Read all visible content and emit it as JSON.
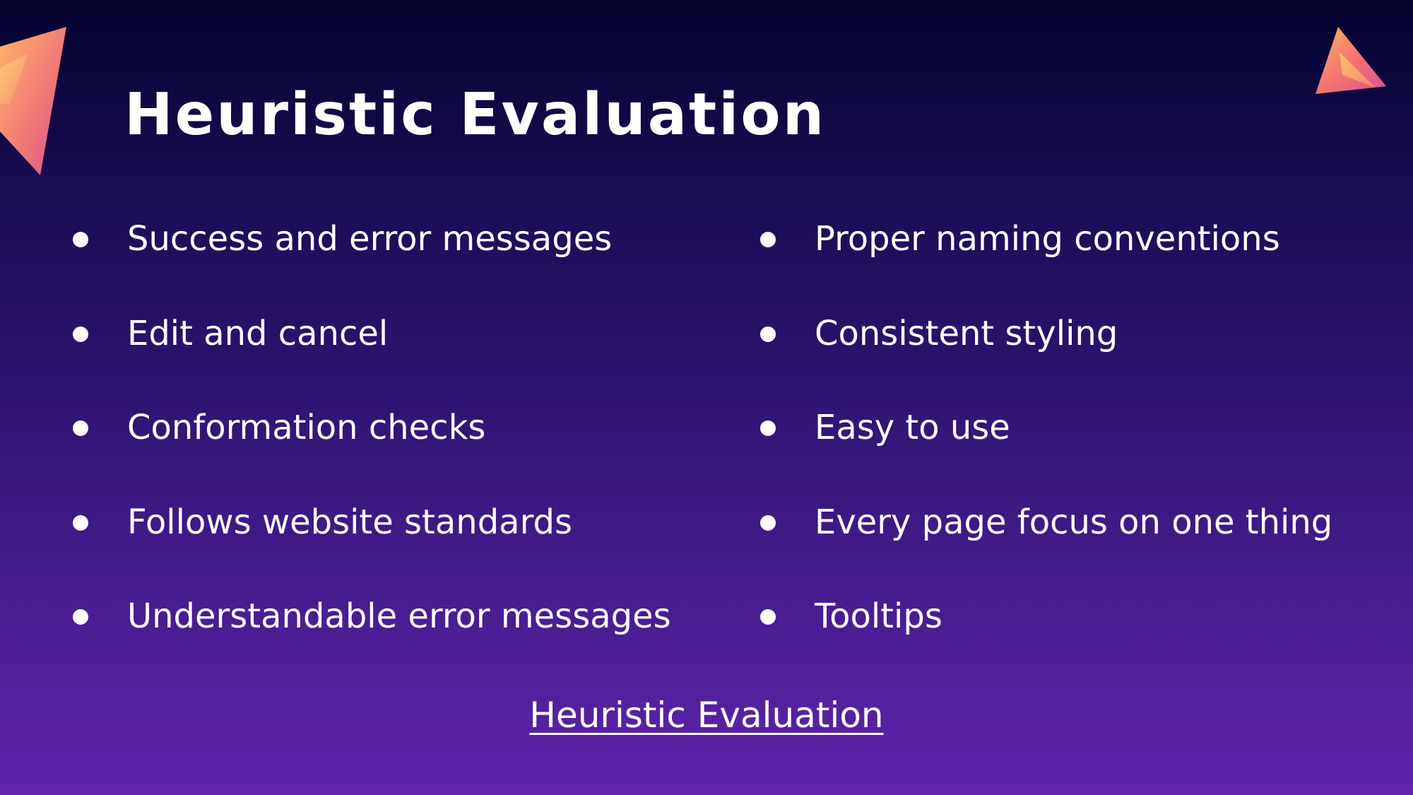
{
  "slide": {
    "title": "Heuristic Evaluation",
    "left_items": [
      "Success and error messages",
      "Edit and cancel",
      "Conformation checks",
      "Follows website standards",
      "Understandable error messages"
    ],
    "right_items": [
      "Proper naming conventions",
      "Consistent styling",
      "Easy to use",
      "Every page focus on one thing",
      "Tooltips"
    ],
    "footer_link": "Heuristic Evaluation"
  },
  "colors": {
    "background_top": "#03032e",
    "background_bottom": "#5f25ab",
    "text": "#ffffff",
    "accent_pink": "#e8538f",
    "accent_orange": "#ffa85c"
  },
  "icons": {
    "left_decor": "gradient-triangle-shard",
    "right_decor": "gradient-triangle-shard"
  }
}
